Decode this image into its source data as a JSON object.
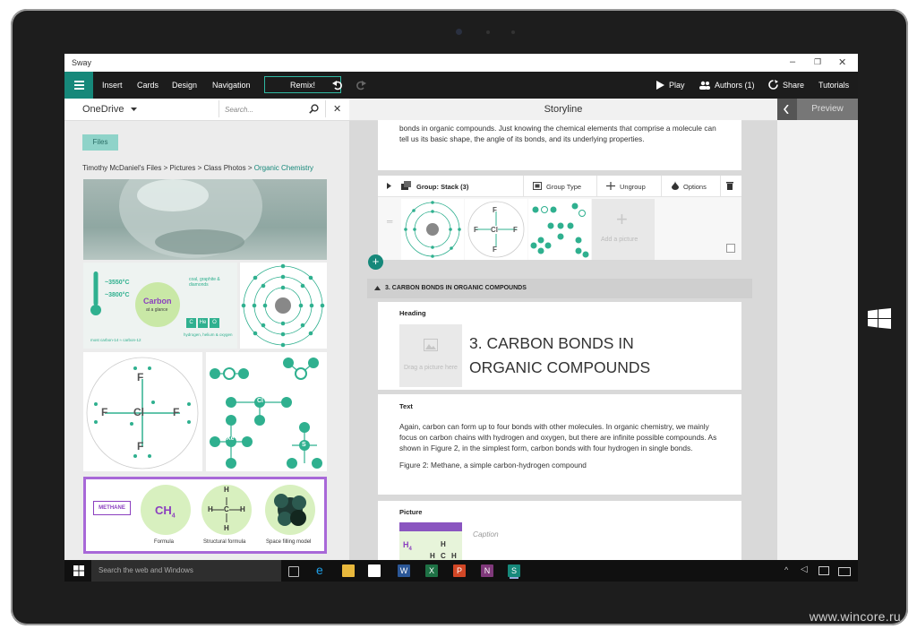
{
  "app": {
    "title": "Sway"
  },
  "menu": {
    "items": [
      "Insert",
      "Cards",
      "Design",
      "Navigation"
    ],
    "remix": "Remix!",
    "play": "Play",
    "authors": "Authors (1)",
    "share": "Share",
    "tutorials": "Tutorials"
  },
  "left": {
    "source": "OneDrive",
    "search_placeholder": "Search...",
    "files_button": "Files",
    "breadcrumb_path": "Timothy McDaniel's Files > Pictures > Class Photos > ",
    "breadcrumb_current": "Organic Chemistry"
  },
  "carbon_infographic": {
    "temp1": "~3550°C",
    "temp2": "~3800°C",
    "title": "Carbon",
    "subtitle": "at a glance",
    "caption": "coal, graphite & diamonds",
    "elements": [
      "C",
      "He",
      "O"
    ],
    "footer1": "most carbon-14 ≈ carbon-12",
    "footer2": "hydrogen, helium & oxygen"
  },
  "molecule_labels": {
    "f": "F",
    "cl": "Cl",
    "xe": "Xe",
    "o": "O",
    "s": "S"
  },
  "methane_tile": {
    "tag": "METHANE",
    "formula": "CH",
    "formula_sub": "4",
    "label1": "Formula",
    "label2": "Structural formula",
    "label3": "Space filling model",
    "h": "H",
    "c": "C"
  },
  "storyline": {
    "header": "Storyline",
    "preview": "Preview",
    "intro_text": "bonds in organic compounds. Just knowing the chemical elements that comprise a molecule can tell us its basic shape, the angle of its bonds, and its underlying properties.",
    "group": {
      "title": "Group: Stack (3)",
      "group_type": "Group Type",
      "ungroup": "Ungroup",
      "options": "Options",
      "add_picture": "Add a picture"
    },
    "section_title": "3. CARBON BONDS IN ORGANIC COMPOUNDS",
    "heading_label": "Heading",
    "heading_text_line1": "3. CARBON BONDS IN",
    "heading_text_line2": "ORGANIC COMPOUNDS",
    "drag_picture": "Drag a picture here",
    "text_label": "Text",
    "text_body": "Again, carbon can form up to four bonds with other molecules. In organic chemistry, we mainly focus on carbon chains with hydrogen and oxygen, but there are infinite possible compounds. As shown in Figure 2, in the simplest form, carbon bonds with four hydrogen in single bonds.",
    "figure_caption": "Figure 2: Methane, a simple carbon-hydrogen compound",
    "picture_label": "Picture",
    "caption_placeholder": "Caption"
  },
  "taskbar": {
    "search": "Search the web and Windows"
  },
  "watermark": "www.wincore.ru",
  "colors": {
    "accent": "#16887a",
    "teal": "#2fb08f",
    "purple": "#8b3fbf"
  }
}
